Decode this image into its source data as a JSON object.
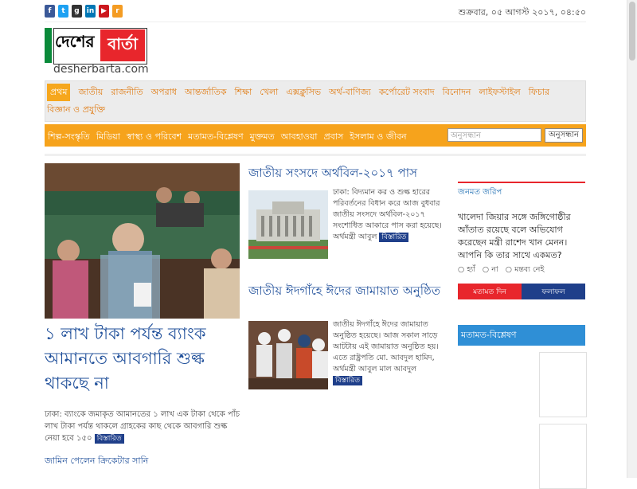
{
  "header": {
    "social_icons": [
      {
        "name": "facebook-icon",
        "glyph": "f",
        "color": "#3b5998"
      },
      {
        "name": "twitter-icon",
        "glyph": "t",
        "color": "#1da1f2"
      },
      {
        "name": "googleplus-icon",
        "glyph": "g",
        "color": "#333333"
      },
      {
        "name": "linkedin-icon",
        "glyph": "in",
        "color": "#0077b5"
      },
      {
        "name": "youtube-icon",
        "glyph": "▶",
        "color": "#cc181e"
      },
      {
        "name": "rss-icon",
        "glyph": "r",
        "color": "#f49c23"
      }
    ],
    "date": "শুক্রবার, ০৫ আগস্ট ২০১৭, ০৪:৫০"
  },
  "logo": {
    "part1": "দেশের",
    "part2": "বার্তা",
    "domain": "desherbarta.com"
  },
  "nav_primary": {
    "items": [
      "প্রথম",
      "জাতীয়",
      "রাজনীতি",
      "অপরাধ",
      "আন্তর্জাতিক",
      "শিক্ষা",
      "খেলা",
      "এক্সক্লুসিভ",
      "অর্থ-বাণিজ্য",
      "কর্পোরেট সংবাদ",
      "বিনোদন",
      "লাইফস্টাইল",
      "ফিচার",
      "বিজ্ঞান ও প্রযুক্তি"
    ],
    "active_index": 0
  },
  "nav_secondary": {
    "items": [
      "শিল্প-সংস্কৃতি",
      "মিডিয়া",
      "স্বাস্থ্য ও পরিবেশ",
      "মতামত-বিশ্লেষণ",
      "মুক্তমত",
      "আবহাওয়া",
      "প্রবাস",
      "ইসলাম ও জীবন"
    ],
    "search_placeholder": "অনুসন্ধান",
    "search_button": "অনুসন্ধান"
  },
  "lead": {
    "title": "১ লাখ টাকা পর্যন্ত ব্যাংক আমানতে আবগারি শুল্ক থাকছে না",
    "summary": "ঢাকা: ব্যাংকে জমাকৃত আমানতের ১ লাখ এক টাকা থেকে পাঁচ লাখ টাকা পর্যন্ত থাকলে গ্রাহকের কাছ থেকে আবগারি শুল্ক নেয়া হবে ১৫০",
    "more": "বিস্তারিত",
    "link": "জামিন পেলেন ক্রিকেটার সানি"
  },
  "mid_stories": [
    {
      "title": "জাতীয় সংসদে অর্থবিল-২০১৭ পাস",
      "text": "ঢাকা: বিদ্যমান কর ও শুল্ক হারের পরিবর্তনের বিধান করে আজ বুধবার জাতীয় সংসদে অর্থবিল-২০১৭ সংশোধিত আকারে পাস করা হয়েছে। অর্থমন্ত্রী আবুল",
      "more": "বিস্তারিত"
    },
    {
      "title": "জাতীয় ঈদগাঁহে ঈদের জামায়াত অনুষ্ঠিত",
      "text": "জাতীয় ঈদগাঁহে ঈদের জামায়াত অনুষ্ঠিত হয়েছে। আজ সকাল সাড়ে আটটায় এই জামায়াত অনুষ্ঠিত হয়। এতে রাষ্ট্রপতি মো. আবদুল হামিদ, অর্থমন্ত্রী আবুল মাল আবদুল",
      "more": "বিস্তারিত"
    }
  ],
  "sidebar": {
    "poll_label": "জনমত জরিপ",
    "poll_question": "খালেদা জিয়ার সঙ্গে জঙ্গিগোষ্ঠীর আঁতাত রয়েছে বলে অভিযোগ করেছেন মন্ত্রী রাশেদ খান মেনন। আপনি কি তার সাথে একমত?",
    "poll_options": [
      "হ্যাঁ",
      "না",
      "মন্তব্য নেই"
    ],
    "vote_button": "মতামত দিন",
    "results_button": "ফলাফল",
    "opinion_header": "মতামত-বিশ্লেষণ"
  }
}
